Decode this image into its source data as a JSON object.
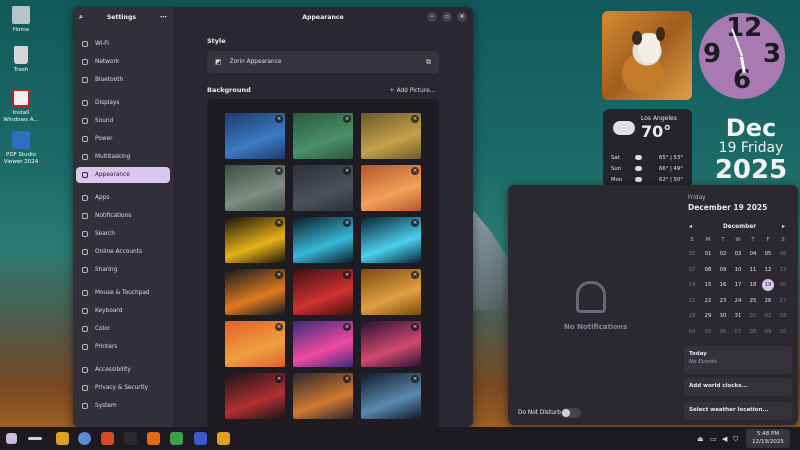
{
  "desktop": {
    "icons": [
      {
        "label": "Home",
        "icon": "home-folder-icon",
        "color": "#b9c3cc"
      },
      {
        "label": "Trash",
        "icon": "trash-icon",
        "color": "#d5d5d5"
      },
      {
        "label": "Install Windows A...",
        "icon": "install-app-icon",
        "color": "#e8e8e8"
      },
      {
        "label": "PDF Studio Viewer 2024",
        "icon": "pdf-studio-icon",
        "color": "#2f6fc1"
      }
    ]
  },
  "settings": {
    "sidebar_title": "Settings",
    "window_title": "Appearance",
    "sidebar_items": [
      {
        "label": "Wi-Fi",
        "icon": "wifi-icon"
      },
      {
        "label": "Network",
        "icon": "network-icon"
      },
      {
        "label": "Bluetooth",
        "icon": "bluetooth-icon"
      },
      {
        "label": "Displays",
        "icon": "display-icon"
      },
      {
        "label": "Sound",
        "icon": "speaker-icon"
      },
      {
        "label": "Power",
        "icon": "power-icon"
      },
      {
        "label": "Multitasking",
        "icon": "multitasking-icon"
      },
      {
        "label": "Appearance",
        "icon": "appearance-icon",
        "active": true
      },
      {
        "label": "Apps",
        "icon": "apps-icon"
      },
      {
        "label": "Notifications",
        "icon": "bell-icon"
      },
      {
        "label": "Search",
        "icon": "search-icon"
      },
      {
        "label": "Online Accounts",
        "icon": "accounts-icon"
      },
      {
        "label": "Sharing",
        "icon": "share-icon"
      },
      {
        "label": "Mouse & Touchpad",
        "icon": "mouse-icon"
      },
      {
        "label": "Keyboard",
        "icon": "keyboard-icon"
      },
      {
        "label": "Color",
        "icon": "color-icon"
      },
      {
        "label": "Printers",
        "icon": "printer-icon"
      },
      {
        "label": "Accessibility",
        "icon": "accessibility-icon"
      },
      {
        "label": "Privacy & Security",
        "icon": "privacy-icon"
      },
      {
        "label": "System",
        "icon": "system-icon"
      }
    ],
    "style_label": "Style",
    "style_link": "Zorin Appearance",
    "background_label": "Background",
    "add_picture": "Add Picture...",
    "thumbnail_colors": [
      [
        "#1f3a6e",
        "#3b7bc3"
      ],
      [
        "#2a5a3e",
        "#4a8f6a"
      ],
      [
        "#6b5a2c",
        "#c4a14a"
      ],
      [
        "#3c4f45",
        "#7e8e84"
      ],
      [
        "#2b3038",
        "#4b515a"
      ],
      [
        "#b5562a",
        "#f0a25a"
      ],
      [
        "#1a1408",
        "#e6b21a"
      ],
      [
        "#0b1c24",
        "#38b8d8"
      ],
      [
        "#0a2030",
        "#4ad0f0"
      ],
      [
        "#101820",
        "#e07a20"
      ],
      [
        "#401010",
        "#d03030"
      ],
      [
        "#7a4a12",
        "#e0a040"
      ],
      [
        "#e0602a",
        "#f0a040"
      ],
      [
        "#3a2a7a",
        "#f04aa0"
      ],
      [
        "#2a1030",
        "#d04a70"
      ],
      [
        "#1a1418",
        "#b03030"
      ],
      [
        "#2a2430",
        "#d07a30"
      ],
      [
        "#101a28",
        "#5a8ab0"
      ],
      [
        "#402010",
        "#e07020"
      ],
      [
        "#201828",
        "#6a5aa0"
      ],
      [
        "#181818",
        "#808080"
      ]
    ]
  },
  "weather": {
    "city": "Los Angeles",
    "temp": "70°",
    "forecast": [
      {
        "day": "Sat",
        "range": "65° | 53°"
      },
      {
        "day": "Sun",
        "range": "66° | 49°"
      },
      {
        "day": "Mon",
        "range": "62° | 50°"
      }
    ]
  },
  "clock_widget": {
    "n12": "12",
    "n9": "9",
    "n3": "3",
    "n6": "6"
  },
  "date_widget": {
    "month": "Dec",
    "day_line": "19 Friday",
    "year": "2025"
  },
  "notifications": {
    "empty_text": "No Notifications",
    "dnd_label": "Do Not Disturb",
    "weekday": "Friday",
    "full_date": "December 19 2025",
    "month_label": "December",
    "prev": "◂",
    "next": "▸",
    "weekday_heads": [
      "S",
      "M",
      "T",
      "W",
      "T",
      "F",
      "S"
    ],
    "weeks": [
      [
        "30",
        "01",
        "02",
        "03",
        "04",
        "05",
        "06"
      ],
      [
        "07",
        "08",
        "09",
        "10",
        "11",
        "12",
        "13"
      ],
      [
        "14",
        "15",
        "16",
        "17",
        "18",
        "19",
        "20"
      ],
      [
        "21",
        "22",
        "23",
        "24",
        "25",
        "26",
        "27"
      ],
      [
        "28",
        "29",
        "30",
        "31",
        "01",
        "02",
        "03"
      ],
      [
        "04",
        "05",
        "06",
        "07",
        "08",
        "09",
        "10"
      ]
    ],
    "today_label": "Today",
    "no_events": "No Events",
    "world_clocks": "Add world clocks...",
    "weather_location": "Select weather location..."
  },
  "taskbar": {
    "time": "5:48 PM",
    "date": "12/19/2025",
    "app_colors": [
      "#e0a020",
      "#5a8ad0",
      "#d84a2a",
      "#2a2a2a",
      "#e06a1a",
      "#3aa04a",
      "#3a5ad0",
      "#e0a020"
    ]
  }
}
